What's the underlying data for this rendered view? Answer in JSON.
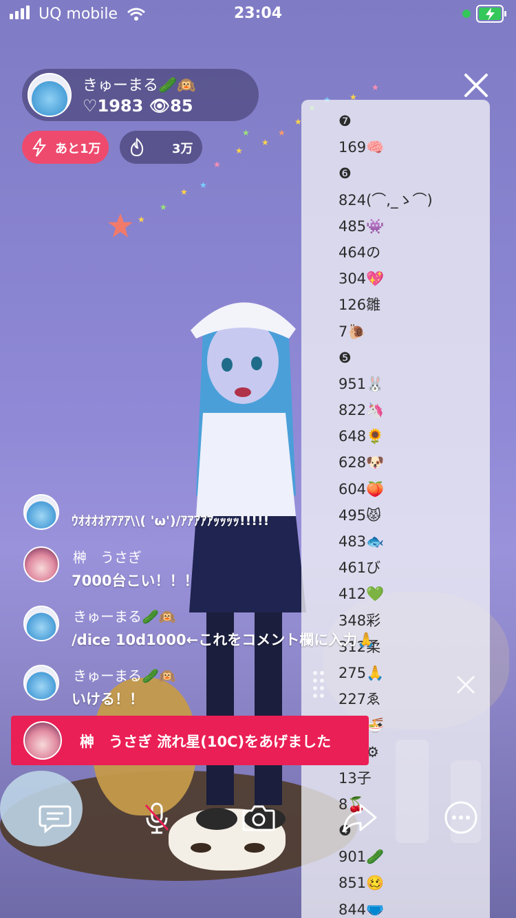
{
  "status_bar": {
    "carrier": "UQ mobile",
    "time": "23:04"
  },
  "profile": {
    "name": "きゅーまる🥒🙉",
    "stats": "♡1983 👁85"
  },
  "chips": {
    "remain_label": "あと1万",
    "fire_label": "3万"
  },
  "ranking_list": [
    "❼",
    "169🧠",
    "❻",
    "824(⌒,_ゝ⌒)",
    "485👾",
    "464の",
    "304💖",
    "126雛",
    "7🐌",
    "❺",
    "951🐰",
    "822🦄",
    "648🌻",
    "628🐶",
    "604🍑",
    "495😾",
    "483🐟",
    "461び",
    "412💚",
    "348彩",
    "312柔",
    "275🙏",
    "227ゑ",
    "192🍜",
    "105⚙",
    "13子",
    "8🍒",
    "❹",
    "901🥒",
    "851🥴",
    "844🩲"
  ],
  "chat": [
    {
      "name": "きゅーまる🥒🙉",
      "message": "ｳｵｵｵｵｱｱｱｱ\\\\( 'ω')/ｱｱｱｱｱｯｯｯｯ!!!!!",
      "avatar": "kyumaru-avatar"
    },
    {
      "name": "榊　うさぎ",
      "message": "7000台こい！！！",
      "avatar": "usagi-avatar"
    },
    {
      "name": "きゅーまる🥒🙉",
      "message": "/dice 10d1000←これをコメント欄に入力🙏",
      "avatar": "kyumaru-avatar"
    },
    {
      "name": "きゅーまる🥒🙉",
      "message": "いける！！",
      "avatar": "kyumaru-avatar"
    }
  ],
  "gift_banner": {
    "text": "榊　うさぎ 流れ星(10C)をあげました"
  },
  "toolbar": [
    "comment-icon",
    "mic-off-icon",
    "camera-icon",
    "share-icon",
    "more-icon"
  ],
  "colors": {
    "accent": "#ea1f55",
    "chip_pink": "#ee4a6e",
    "battery": "#34c759"
  }
}
